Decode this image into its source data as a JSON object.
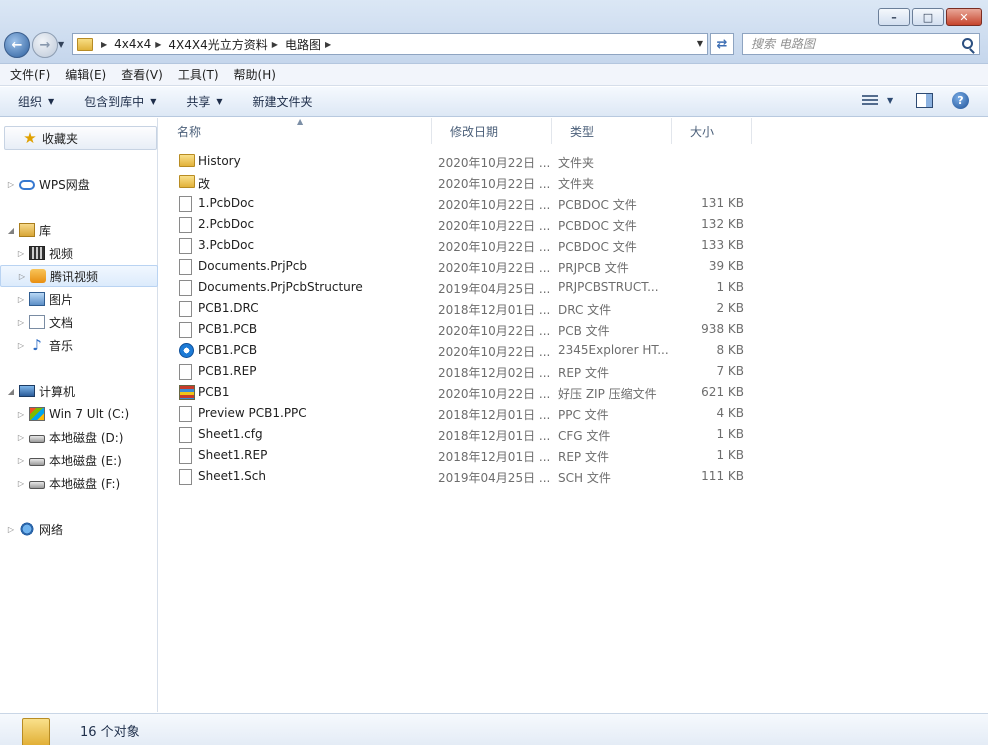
{
  "window": {
    "minimize_glyph": "–",
    "maximize_glyph": "□",
    "close_glyph": "✕"
  },
  "address": {
    "crumbs": [
      "4x4x4",
      "4X4X4光立方资料",
      "电路图"
    ]
  },
  "search": {
    "placeholder": "搜索 电路图"
  },
  "menu": [
    "文件(F)",
    "编辑(E)",
    "查看(V)",
    "工具(T)",
    "帮助(H)"
  ],
  "toolbar": {
    "organize": "组织",
    "include_library": "包含到库中",
    "share": "共享",
    "new_folder": "新建文件夹"
  },
  "nav": {
    "favorites": "收藏夹",
    "wps": "WPS网盘",
    "library": "库",
    "video": "视频",
    "tencent_video": "腾讯视频",
    "pictures": "图片",
    "documents": "文档",
    "music": "音乐",
    "computer": "计算机",
    "drive_c": "Win 7 Ult (C:)",
    "drive_d": "本地磁盘 (D:)",
    "drive_e": "本地磁盘 (E:)",
    "drive_f": "本地磁盘 (F:)",
    "network": "网络"
  },
  "columns": {
    "name": "名称",
    "date": "修改日期",
    "type": "类型",
    "size": "大小"
  },
  "files": [
    {
      "icon": "folder-icon",
      "name": "History",
      "date": "2020年10月22日 ...",
      "type": "文件夹",
      "size": ""
    },
    {
      "icon": "folder-icon",
      "name": "改",
      "date": "2020年10月22日 ...",
      "type": "文件夹",
      "size": ""
    },
    {
      "icon": "file-icon",
      "name": "1.PcbDoc",
      "date": "2020年10月22日 ...",
      "type": "PCBDOC 文件",
      "size": "131 KB"
    },
    {
      "icon": "file-icon",
      "name": "2.PcbDoc",
      "date": "2020年10月22日 ...",
      "type": "PCBDOC 文件",
      "size": "132 KB"
    },
    {
      "icon": "file-icon",
      "name": "3.PcbDoc",
      "date": "2020年10月22日 ...",
      "type": "PCBDOC 文件",
      "size": "133 KB"
    },
    {
      "icon": "file-icon",
      "name": "Documents.PrjPcb",
      "date": "2020年10月22日 ...",
      "type": "PRJPCB 文件",
      "size": "39 KB"
    },
    {
      "icon": "file-icon",
      "name": "Documents.PrjPcbStructure",
      "date": "2019年04月25日 ...",
      "type": "PRJPCBSTRUCT...",
      "size": "1 KB"
    },
    {
      "icon": "file-icon",
      "name": "PCB1.DRC",
      "date": "2018年12月01日 ...",
      "type": "DRC 文件",
      "size": "2 KB"
    },
    {
      "icon": "file-icon",
      "name": "PCB1.PCB",
      "date": "2020年10月22日 ...",
      "type": "PCB 文件",
      "size": "938 KB"
    },
    {
      "icon": "browser-icon",
      "name": "PCB1.PCB",
      "date": "2020年10月22日 ...",
      "type": "2345Explorer HT...",
      "size": "8 KB"
    },
    {
      "icon": "file-icon",
      "name": "PCB1.REP",
      "date": "2018年12月02日 ...",
      "type": "REP 文件",
      "size": "7 KB"
    },
    {
      "icon": "zip-icon",
      "name": "PCB1",
      "date": "2020年10月22日 ...",
      "type": "好压 ZIP 压缩文件",
      "size": "621 KB"
    },
    {
      "icon": "file-icon",
      "name": "Preview PCB1.PPC",
      "date": "2018年12月01日 ...",
      "type": "PPC 文件",
      "size": "4 KB"
    },
    {
      "icon": "file-icon",
      "name": "Sheet1.cfg",
      "date": "2018年12月01日 ...",
      "type": "CFG 文件",
      "size": "1 KB"
    },
    {
      "icon": "file-icon",
      "name": "Sheet1.REP",
      "date": "2018年12月01日 ...",
      "type": "REP 文件",
      "size": "1 KB"
    },
    {
      "icon": "file-icon",
      "name": "Sheet1.Sch",
      "date": "2019年04月25日 ...",
      "type": "SCH 文件",
      "size": "111 KB"
    }
  ],
  "status": {
    "count": "16 个对象"
  }
}
